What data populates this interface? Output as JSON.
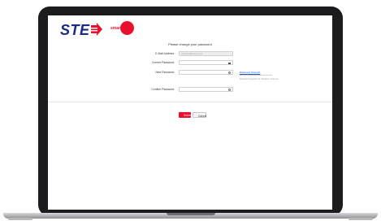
{
  "brand": {
    "logo_text": "STE",
    "partner_text": "smart",
    "accent_color": "#e8112d",
    "logo_color": "#1a2a8a"
  },
  "form": {
    "title": "Please change your password",
    "email": {
      "label": "E-Mail Address:",
      "value": "xxxxxxx@xxxxx.xxx"
    },
    "current_password": {
      "label": "Current Password:",
      "icon": "keyboard-icon"
    },
    "new_password": {
      "label": "New Password:",
      "icon": "eye-icon"
    },
    "confirm_password": {
      "label": "Confirm Password:",
      "icon": "eye-icon"
    },
    "strength": {
      "link": "Password Strength",
      "note": "Password requires 10 character minimum"
    },
    "submit_label": "Submit",
    "cancel_label": "Cancel"
  }
}
